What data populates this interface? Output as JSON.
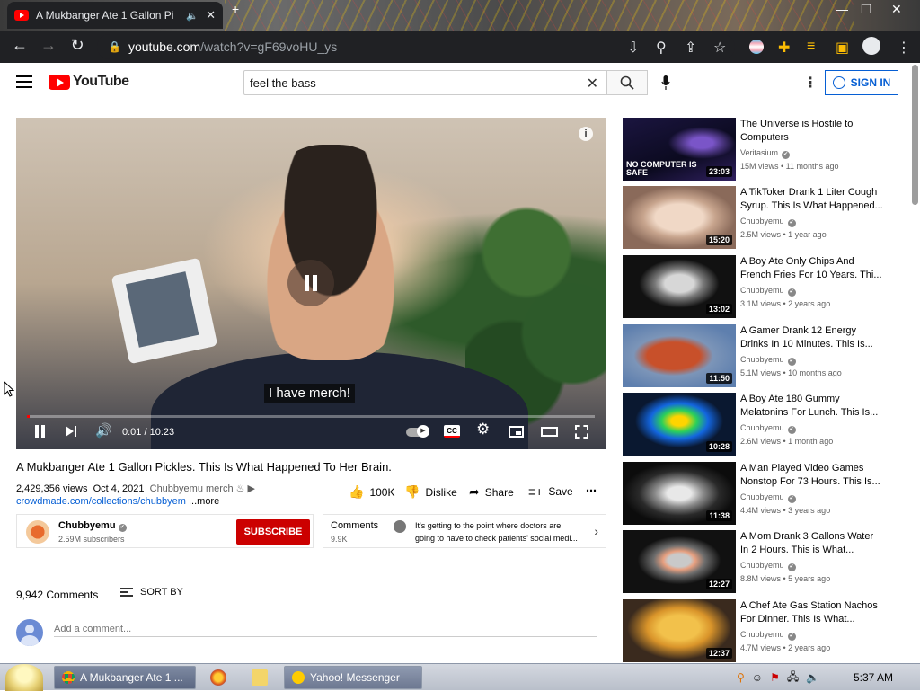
{
  "browser": {
    "tab_title": "A Mukbanger Ate 1 Gallon Pi",
    "url_host": "youtube.com",
    "url_path": "/watch?v=gF69voHU_ys"
  },
  "header": {
    "logo_text": "YouTube",
    "search_value": "feel the bass",
    "signin_label": "SIGN IN"
  },
  "player": {
    "caption": "I have merch!",
    "time": "0:01 / 10:23",
    "progress": 0.0016
  },
  "video": {
    "title": "A Mukbanger Ate 1 Gallon Pickles. This Is What Happened To Her Brain.",
    "views": "2,429,356 views",
    "date": "Oct 4, 2021",
    "merch_text": "Chubbyemu merch",
    "link": "crowdmade.com/collections/chubbyem",
    "more": "...more",
    "likes": "100K",
    "dislike": "Dislike",
    "share": "Share",
    "save": "Save"
  },
  "channel": {
    "name": "Chubbyemu",
    "subs": "2.59M subscribers",
    "subscribe": "SUBSCRIBE"
  },
  "comments": {
    "label": "Comments",
    "count": "9.9K",
    "preview": "It's getting to the point where doctors are going to have to check patients' social medi...",
    "total": "9,942 Comments",
    "sort_by": "SORT BY",
    "placeholder": "Add a comment..."
  },
  "recommendations": [
    {
      "title": "The Universe is Hostile to Computers",
      "channel": "Veritasium",
      "meta": "15M views • 11 months ago",
      "duration": "23:03",
      "overlay": "NO COMPUTER IS SAFE"
    },
    {
      "title": "A TikToker Drank 1 Liter Cough Syrup. This Is What Happened...",
      "channel": "Chubbyemu",
      "meta": "2.5M views • 1 year ago",
      "duration": "15:20"
    },
    {
      "title": "A Boy Ate Only Chips And French Fries For 10 Years. Thi...",
      "channel": "Chubbyemu",
      "meta": "3.1M views • 2 years ago",
      "duration": "13:02"
    },
    {
      "title": "A Gamer Drank 12 Energy Drinks In 10 Minutes. This Is...",
      "channel": "Chubbyemu",
      "meta": "5.1M views • 10 months ago",
      "duration": "11:50"
    },
    {
      "title": "A Boy Ate 180 Gummy Melatonins For Lunch. This Is...",
      "channel": "Chubbyemu",
      "meta": "2.6M views • 1 month ago",
      "duration": "10:28"
    },
    {
      "title": "A Man Played Video Games Nonstop For 73 Hours. This Is...",
      "channel": "Chubbyemu",
      "meta": "4.4M views • 3 years ago",
      "duration": "11:38"
    },
    {
      "title": "A Mom Drank 3 Gallons Water In 2 Hours. This is What...",
      "channel": "Chubbyemu",
      "meta": "8.8M views • 5 years ago",
      "duration": "12:27"
    },
    {
      "title": "A Chef Ate Gas Station Nachos For Dinner. This Is What...",
      "channel": "Chubbyemu",
      "meta": "4.7M views • 2 years ago",
      "duration": "12:37"
    }
  ],
  "taskbar": {
    "chrome_task": "A Mukbanger Ate 1 ...",
    "yahoo_task": "Yahoo! Messenger",
    "clock": "5:37 AM"
  },
  "colors": {
    "accent_red": "#ff0000",
    "subscribe_red": "#cc0000",
    "link_blue": "#065fd4"
  }
}
